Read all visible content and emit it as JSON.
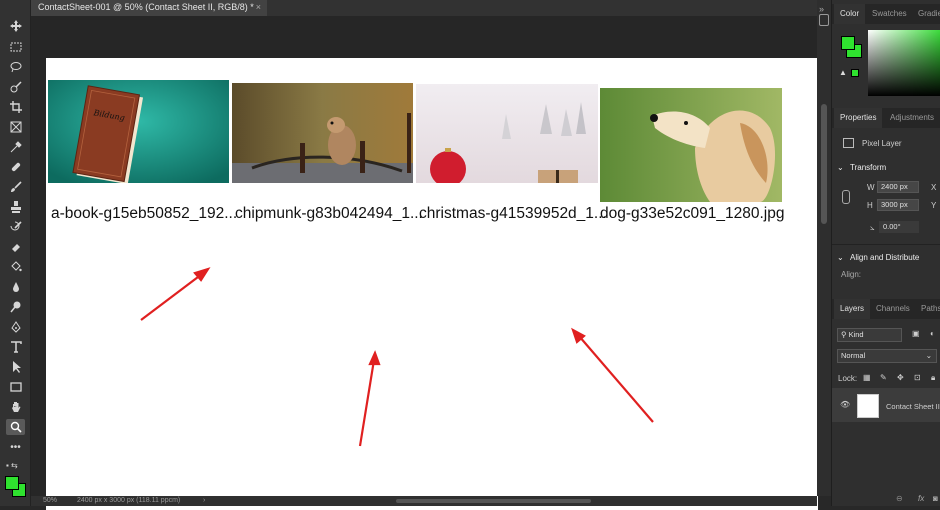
{
  "document": {
    "tab_title": "ContactSheet-001 @ 50% (Contact Sheet II, RGB/8) *",
    "close": "×"
  },
  "canvas": {
    "filenames": [
      "a-book-g15eb50852_192...",
      "chipmunk-g83b042494_1...",
      "christmas-g41539952d_1...",
      "dog-g33e52c091_1280.jpg"
    ],
    "book_title": "Bildung"
  },
  "statusbar": {
    "zoom": "50%",
    "info": "2400 px x 3000 px (118.11 ppcm)",
    "chevron": "›"
  },
  "panels": {
    "color_tabs": [
      "Color",
      "Swatches",
      "Gradie"
    ],
    "properties_tabs": [
      "Properties",
      "Adjustments"
    ],
    "pixel_layer": "Pixel Layer",
    "transform_title": "Transform",
    "width_label": "W",
    "width_value": "2400 px",
    "height_label": "H",
    "height_value": "3000 px",
    "x_label": "X",
    "y_label": "Y",
    "angle_value": "0.00°",
    "align_title": "Align and Distribute",
    "align_label": "Align:",
    "layers_tabs": [
      "Layers",
      "Channels",
      "Paths"
    ],
    "kind_label": "Kind",
    "blend_mode": "Normal",
    "lock_label": "Lock:",
    "layer_name": "Contact Sheet II"
  },
  "colors": {
    "foreground": "#2fe22f",
    "background": "#2fe22f",
    "arrow": "#e02020"
  },
  "icons": [
    "move-icon",
    "marquee-icon",
    "lasso-icon",
    "quick-select-icon",
    "crop-icon",
    "frame-icon",
    "eyedropper-icon",
    "healing-icon",
    "brush-icon",
    "stamp-icon",
    "history-brush-icon",
    "eraser-icon",
    "paint-bucket-icon",
    "blur-icon",
    "dodge-icon",
    "pen-icon",
    "type-icon",
    "path-select-icon",
    "rectangle-icon",
    "hand-icon",
    "zoom-icon"
  ]
}
